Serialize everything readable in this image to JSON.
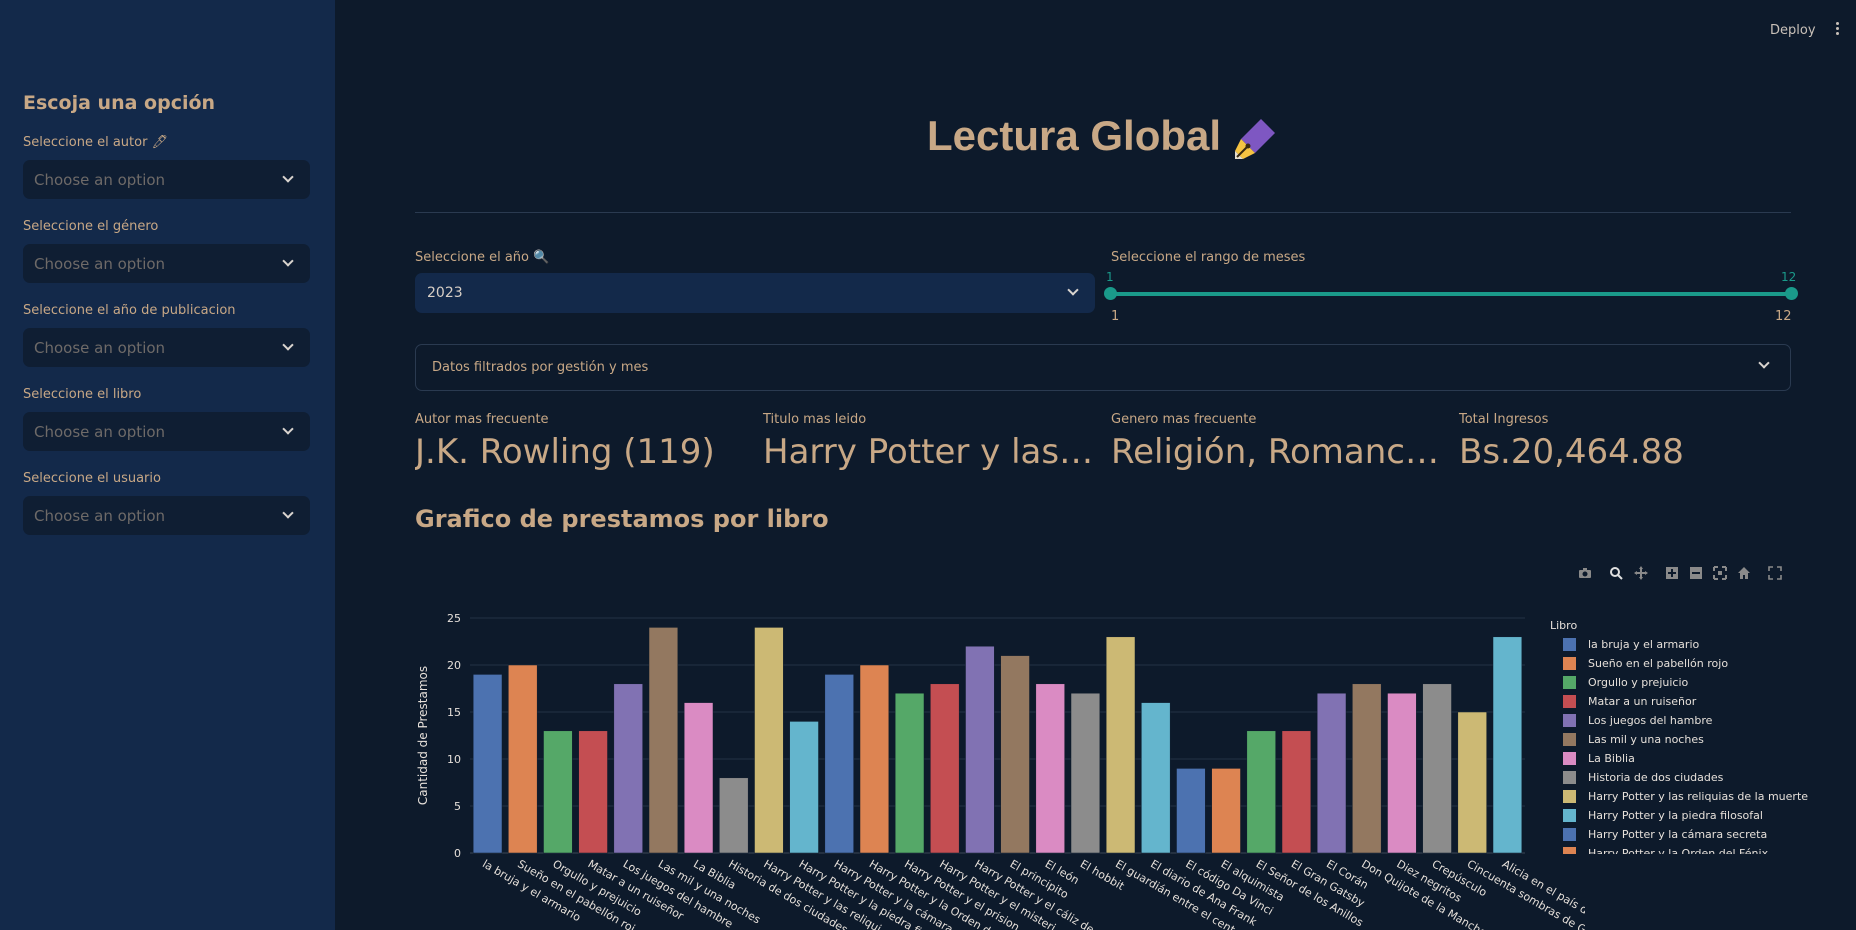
{
  "sidebar": {
    "title": "Escoja una opción",
    "filters": [
      {
        "label": "Seleccione el autor 🖊",
        "placeholder": "Choose an option"
      },
      {
        "label": "Seleccione el género",
        "placeholder": "Choose an option"
      },
      {
        "label": "Seleccione el año de publicacion",
        "placeholder": "Choose an option"
      },
      {
        "label": "Seleccione el libro",
        "placeholder": "Choose an option"
      },
      {
        "label": "Seleccione el usuario",
        "placeholder": "Choose an option"
      }
    ]
  },
  "topbar": {
    "deploy_label": "Deploy"
  },
  "header": {
    "title": "Lectura Global"
  },
  "controls": {
    "year_label": "Seleccione el año 🔍",
    "year_value": "2023",
    "month_label": "Seleccione el rango de meses",
    "month_min": "1",
    "month_max": "12",
    "month_value_low": "1",
    "month_value_high": "12"
  },
  "expander": {
    "label": "Datos filtrados por gestión y mes"
  },
  "metrics": [
    {
      "label": "Autor mas frecuente",
      "value": "J.K. Rowling (119)"
    },
    {
      "label": "Titulo mas leido",
      "value": "Harry Potter y las re…"
    },
    {
      "label": "Genero mas frecuente",
      "value": "Religión, Romance (…"
    },
    {
      "label": "Total Ingresos",
      "value": "Bs.20,464.88"
    }
  ],
  "section": {
    "title": "Grafico de prestamos por libro"
  },
  "colors": {
    "accent": "#1a9a8a",
    "text": "#c8a886",
    "sidebar": "#13294a",
    "background": "#0d1a2b"
  },
  "chart_data": {
    "type": "bar",
    "ylabel": "Cantidad de Prestamos",
    "legend_title": "Libro",
    "legend_position": "right",
    "ylim": [
      0,
      25
    ],
    "y_ticks": [
      0,
      5,
      10,
      15,
      20,
      25
    ],
    "grid": true,
    "categories": [
      "la bruja y el armario",
      "Sueño en el pabellón rojo",
      "Orgullo y prejuicio",
      "Matar a un ruiseñor",
      "Los juegos del hambre",
      "Las mil y una noches",
      "La Biblia",
      "Historia de dos ciudades",
      "Harry Potter y las reliquias de la muerte",
      "Harry Potter y la piedra filosofal",
      "Harry Potter y la cámara secreta",
      "Harry Potter y la Orden del Fénix",
      "Harry Potter y el prisionero de Azkaban",
      "Harry Potter y el misterio del príncipe",
      "Harry Potter y el cáliz de fuego",
      "El principito",
      "El león",
      "El hobbit",
      "El guardián entre el centeno",
      "El diario de Ana Frank",
      "El código Da Vinci",
      "El alquimista",
      "El Señor de los Anillos",
      "El Gran Gatsby",
      "El Corán",
      "Don Quijote de la Mancha",
      "Diez negritos",
      "Crepúsculo",
      "Cincuenta sombras de Grey",
      "Alicia en el país de las maravillas"
    ],
    "x_tick_labels": [
      "la bruja y el armario",
      "Sueño en el pabellón roj",
      "Orgullo y prejuicio",
      "Matar a un ruiseñor",
      "Los juegos del hambre",
      "Las mil y una noches",
      "La Biblia",
      "Historia de dos ciudades",
      "Harry Potter y las reliqui",
      "Harry Potter y la piedra fi",
      "Harry Potter y la cámara",
      "Harry Potter y la Orden d",
      "Harry Potter y el prision",
      "Harry Potter y el misteri",
      "Harry Potter y el cáliz de",
      "El principito",
      "El león",
      "El hobbit",
      "El guardián entre el cent",
      "El diario de Ana Frank",
      "El código Da Vinci",
      "El alquimista",
      "El Señor de los Anillos",
      "El Gran Gatsby",
      "El Corán",
      "Don Quijote de la Mancha",
      "Diez negritos",
      "Crepúsculo",
      "Cincuenta sombras de G",
      "Alicia en el país de las m"
    ],
    "values": [
      19,
      20,
      13,
      13,
      18,
      24,
      16,
      8,
      24,
      14,
      19,
      20,
      17,
      18,
      22,
      21,
      18,
      17,
      23,
      16,
      9,
      9,
      13,
      13,
      17,
      18,
      17,
      18,
      15,
      23
    ],
    "colors": [
      "#4c72b0",
      "#dd8452",
      "#55a868",
      "#c44e52",
      "#8172b3",
      "#937860",
      "#da8bc3",
      "#8c8c8c",
      "#ccb974",
      "#64b5cd"
    ],
    "legend_entries": [
      "la bruja y el armario",
      "Sueño en el pabellón rojo",
      "Orgullo y prejuicio",
      "Matar a un ruiseñor",
      "Los juegos del hambre",
      "Las mil y una noches",
      "La Biblia",
      "Historia de dos ciudades",
      "Harry Potter y las reliquias de la muerte",
      "Harry Potter y la piedra filosofal",
      "Harry Potter y la cámara secreta",
      "Harry Potter y la Orden del Fénix"
    ]
  },
  "modebar_icons": [
    "camera-icon",
    "zoom-icon",
    "pan-icon",
    "zoom-in-icon",
    "zoom-out-icon",
    "autoscale-icon",
    "home-icon",
    "fullscreen-icon"
  ]
}
